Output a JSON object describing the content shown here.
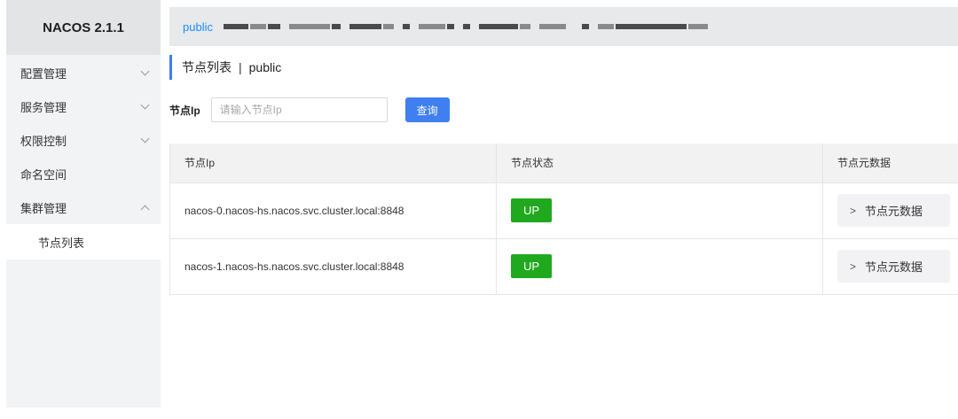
{
  "app": {
    "title": "NACOS 2.1.1"
  },
  "sidebar": {
    "items": [
      {
        "label": "配置管理",
        "expanded": false
      },
      {
        "label": "服务管理",
        "expanded": false
      },
      {
        "label": "权限控制",
        "expanded": false
      },
      {
        "label": "命名空间"
      },
      {
        "label": "集群管理",
        "expanded": true
      }
    ],
    "subitems": [
      {
        "label": "节点列表"
      }
    ]
  },
  "namespace_bar": {
    "active": "public"
  },
  "page": {
    "title": "节点列表",
    "separator": "|",
    "namespace": "public"
  },
  "search": {
    "label": "节点Ip",
    "placeholder": "请输入节点Ip",
    "button": "查询"
  },
  "table": {
    "headers": [
      "节点Ip",
      "节点状态",
      "节点元数据"
    ],
    "rows": [
      {
        "ip": "nacos-0.nacos-hs.nacos.svc.cluster.local:8848",
        "status": "UP",
        "metadata": "节点元数据"
      },
      {
        "ip": "nacos-1.nacos-hs.nacos.svc.cluster.local:8848",
        "status": "UP",
        "metadata": "节点元数据"
      }
    ]
  },
  "colors": {
    "accent": "#3f7ff0",
    "status_up": "#20a91f",
    "link": "#1a8cff"
  }
}
